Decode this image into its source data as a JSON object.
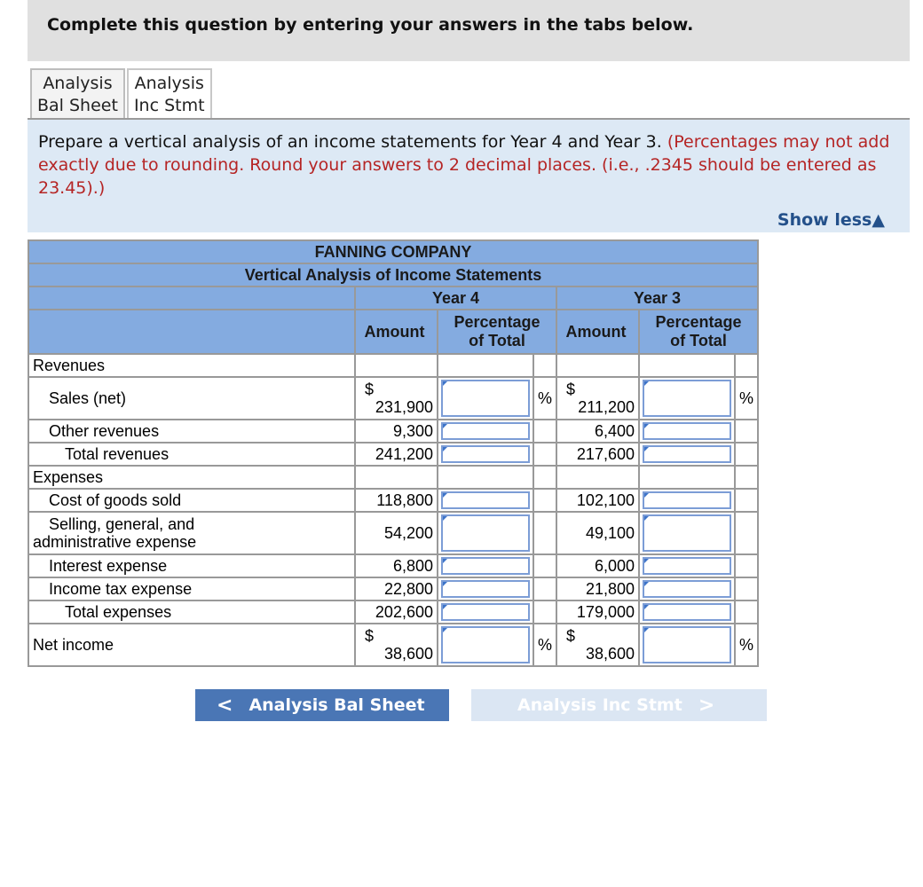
{
  "banner": {
    "text": "Complete this question by entering your answers in the tabs below."
  },
  "tabs": [
    {
      "line1": "Analysis",
      "line2": "Bal Sheet",
      "active": false
    },
    {
      "line1": "Analysis",
      "line2": "Inc Stmt",
      "active": true
    }
  ],
  "instructions": {
    "main": "Prepare a vertical analysis of an income statements for Year 4 and Year 3.",
    "note": "(Percentages may not add exactly due to rounding. Round your answers to 2 decimal places. (i.e., .2345 should be entered as 23.45).)",
    "show_less": "Show less",
    "show_less_icon": "triangle-up-icon"
  },
  "table": {
    "company": "FANNING COMPANY",
    "title": "Vertical Analysis of Income Statements",
    "year4": "Year 4",
    "year3": "Year 3",
    "col_amount": "Amount",
    "col_pct_line1": "Percentage",
    "col_pct_line2": "of Total",
    "currency": "$",
    "percent": "%",
    "sections": {
      "revenues": "Revenues",
      "expenses": "Expenses"
    },
    "rows": {
      "sales": {
        "label": "Sales (net)",
        "y4": "231,900",
        "y3": "211,200",
        "y4_pct": "",
        "y3_pct": ""
      },
      "other_rev": {
        "label": "Other revenues",
        "y4": "9,300",
        "y3": "6,400",
        "y4_pct": "",
        "y3_pct": ""
      },
      "total_rev": {
        "label": "Total revenues",
        "y4": "241,200",
        "y3": "217,600",
        "y4_pct": "",
        "y3_pct": ""
      },
      "cogs": {
        "label": "Cost of goods sold",
        "y4": "118,800",
        "y3": "102,100",
        "y4_pct": "",
        "y3_pct": ""
      },
      "sga": {
        "label_line1": "Selling, general, and",
        "label_line2": "administrative expense",
        "y4": "54,200",
        "y3": "49,100",
        "y4_pct": "",
        "y3_pct": ""
      },
      "interest": {
        "label": "Interest expense",
        "y4": "6,800",
        "y3": "6,000",
        "y4_pct": "",
        "y3_pct": ""
      },
      "tax": {
        "label": "Income tax expense",
        "y4": "22,800",
        "y3": "21,800",
        "y4_pct": "",
        "y3_pct": ""
      },
      "total_exp": {
        "label": "Total expenses",
        "y4": "202,600",
        "y3": "179,000",
        "y4_pct": "",
        "y3_pct": ""
      },
      "net": {
        "label": "Net income",
        "y4": "38,600",
        "y3": "38,600",
        "y4_pct": "",
        "y3_pct": ""
      }
    }
  },
  "nav": {
    "prev_label": "Analysis Bal Sheet",
    "next_label": "Analysis Inc Stmt",
    "next_enabled": false
  }
}
